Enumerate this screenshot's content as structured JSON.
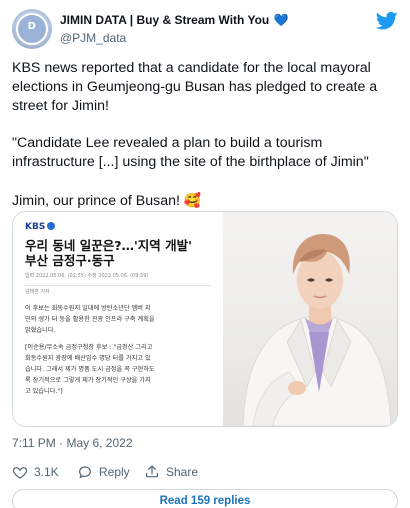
{
  "account": {
    "display_name": "JIMIN DATA | Buy & Stream With You",
    "verified_heart": "💙",
    "handle": "@PJM_data",
    "avatar_text": "D"
  },
  "tweet": {
    "paragraphs": [
      "KBS news reported that a candidate for the local mayoral elections in Geumjeong-gu Busan has pledged to create a street for Jimin!",
      "\"Candidate Lee revealed a plan to build a tourism infrastructure [...] using the site of the birthplace of Jimin\"",
      "Jimin, our prince of Busan! "
    ],
    "emoji": "🥰",
    "timestamp": "7:11 PM · May 6, 2022"
  },
  "media": {
    "article": {
      "source": "KBS",
      "title_line1": "우리 동네 일꾼은?…'지역 개발'",
      "title_line2": "부산 금정구·동구",
      "meta_line1": "입력 2022.05.06. (02:55) 수정 2022.05.06. (09:59)",
      "meta_line2": "김태훈 기자",
      "body_line1": "이 후보는 회동수원지 일대에 방탄소년단 멤버 지",
      "body_line2": "민의 생가 터 등을 활용한 관광 인프라 구축 계획을",
      "body_line3": "밝혔습니다.",
      "quote_line1": "[이순용/무소속 금정구청장 후보 : \"금정산 그리고",
      "quote_line2": "회동수원지 광장에 배산임수 명당 터를 가지고 있",
      "quote_line3": "습니다. 그래서 제가 명품 도시 금정을 꼭 구현하도",
      "quote_line4": "록 장기적으로 그렇게 제가 장기적인 구상을 가지",
      "quote_line5": "고 있습니다.\"]"
    }
  },
  "actions": {
    "likes": "3.1K",
    "reply_label": "Reply",
    "share_label": "Share"
  },
  "replies_button": "Read 159 replies",
  "colors": {
    "accent": "#1d9bf0",
    "text_secondary": "#536471",
    "border": "#cfd9de"
  },
  "icons": {
    "twitter": "twitter-bird-icon",
    "like": "heart-icon",
    "reply": "speech-bubble-icon",
    "share": "share-arrow-icon"
  }
}
